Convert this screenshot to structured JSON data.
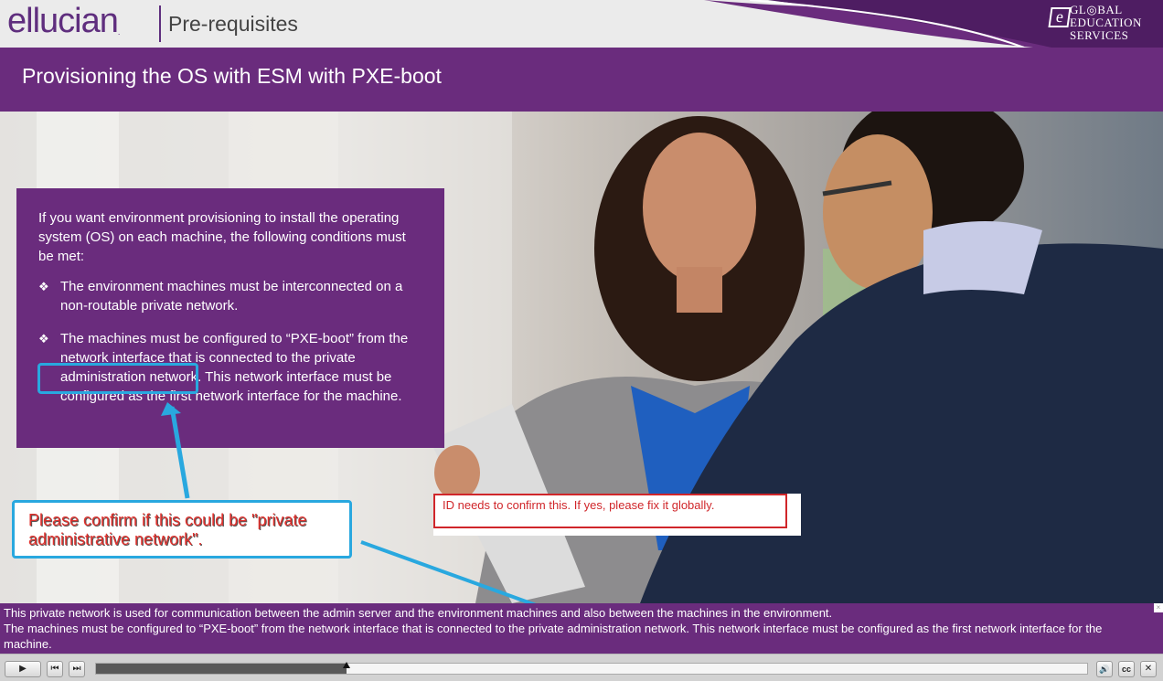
{
  "header": {
    "brand": "ellucian",
    "brand_mark": ".",
    "section": "Pre-requisites",
    "logo_letter": "e",
    "logo_lines": [
      "GL",
      "BAL",
      "EDUCATION",
      "SERVICES"
    ]
  },
  "slide": {
    "title": "Provisioning the OS with ESM with PXE-boot"
  },
  "info_box": {
    "intro": "If you want environment provisioning to install the operating system (OS) on each machine, the following conditions must be met:",
    "bullet_mark": "❖",
    "bullets": [
      "The environment machines must be interconnected on a non-routable private network.",
      "The machines must be configured to “PXE-boot” from the network interface that is connected to the private administration network. This network interface must be configured as the first network interface for the machine."
    ]
  },
  "annotations": {
    "left_note": "Please confirm if this could be \"private administrative network\".",
    "right_note": "ID needs to confirm this. If yes, please fix it globally.",
    "highlight_color": "#29a8df",
    "note_text_color": "#e0302c"
  },
  "captions": {
    "line1": "This private network is used for communication between the admin server and the environment machines and also between the machines in the environment.",
    "line2": "The machines must be configured to “PXE-boot” from the network interface that is connected to the private administration network. This network interface must be configured as the first network interface for the machine.",
    "close_glyph": "×"
  },
  "player": {
    "play_glyph": "▶",
    "prev_glyph": "⏮",
    "next_glyph": "⏭",
    "volume_glyph": "🔊",
    "cc_label": "cc",
    "close_glyph": "✕",
    "progress": 0.253
  },
  "colors": {
    "brand_purple": "#6a2c7d",
    "header_bg": "#ebebeb"
  }
}
